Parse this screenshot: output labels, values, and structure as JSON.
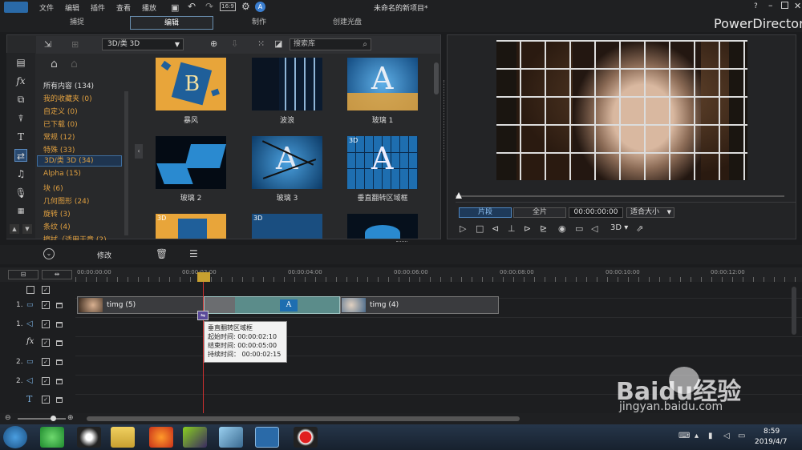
{
  "menu": {
    "items": [
      "文件",
      "编辑",
      "插件",
      "查看",
      "播放"
    ],
    "project_title": "未命名的新项目*",
    "help": "?"
  },
  "tabs": [
    "捕捉",
    "编辑",
    "制作",
    "创建光盘"
  ],
  "brand": "PowerDirector",
  "library": {
    "filter_value": "3D/类 3D",
    "search_placeholder": "搜索库",
    "categories": [
      "所有内容 (134)",
      "我的收藏夹 (0)",
      "自定义 (0)",
      "已下载 (0)",
      "常规 (12)",
      "特殊 (33)",
      "3D/类 3D (34)",
      "Alpha (15)",
      "块 (6)",
      "几何图形 (24)",
      "旋转 (3)",
      "条纹 (4)",
      "擦拭（适用于章 (2)"
    ],
    "transitions": [
      "暴风",
      "波浪",
      "玻璃 1",
      "玻璃 2",
      "玻璃 3",
      "垂直翻转区域框"
    ],
    "badge_3d": "3D"
  },
  "preview": {
    "mode_clip": "片段",
    "mode_full": "全片",
    "timecode": "00:00:00:00",
    "fit": "适合大小",
    "d3": "3D"
  },
  "timeline": {
    "modify": "修改",
    "ruler": [
      "00:00:00:00",
      "00:00:02:00",
      "00:00:04:00",
      "00:00:06:00",
      "00:00:08:00",
      "00:00:10:00",
      "00:00:12:00"
    ],
    "tracks": [
      "1.",
      "1.",
      "2.",
      "2."
    ],
    "clips": [
      "timg (5)",
      "timg (4)"
    ],
    "tooltip": {
      "title": "垂直翻转区域框",
      "start": "起始时间: 00:00:02:10",
      "end": "结束时间: 00:00:05:00",
      "duration": "持续时间：  00:00:02:15"
    }
  },
  "taskbar": {
    "time": "8:59",
    "date": "2019/4/7"
  },
  "watermark": {
    "brand": "Baidu经验",
    "url": "jingyan.baidu.com"
  },
  "colors": {
    "accent": "#3f6e9e",
    "category": "#e0a040",
    "clip": "#5b8c8a",
    "playhead": "#d23030"
  }
}
